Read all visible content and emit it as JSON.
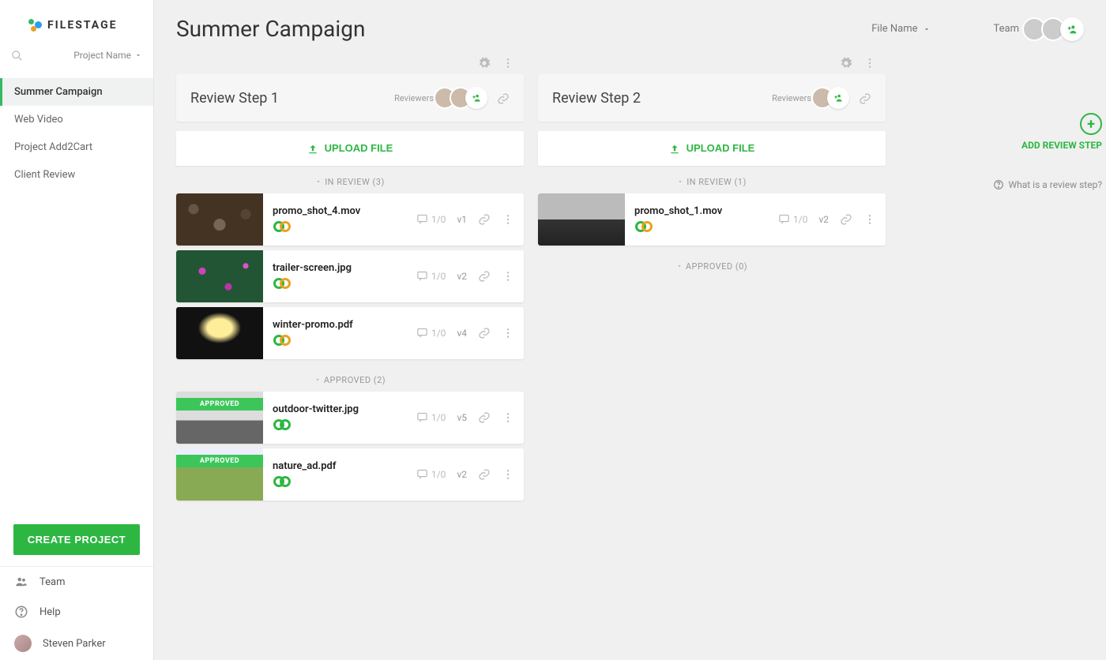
{
  "brand": "FILESTAGE",
  "sidebar": {
    "project_dropdown": "Project Name",
    "projects": [
      {
        "label": "Summer Campaign",
        "active": true
      },
      {
        "label": "Web Video",
        "active": false
      },
      {
        "label": "Project Add2Cart",
        "active": false
      },
      {
        "label": "Client Review",
        "active": false
      }
    ],
    "create_btn": "CREATE PROJECT",
    "footer": {
      "team": "Team",
      "help": "Help",
      "user": "Steven Parker"
    }
  },
  "header": {
    "title": "Summer Campaign",
    "filename_sort": "File Name",
    "team_label": "Team"
  },
  "labels": {
    "reviewers": "Reviewers",
    "upload": "UPLOAD FILE",
    "approved_banner": "APPROVED",
    "add_step": "ADD REVIEW STEP",
    "what_link": "What is a review step?"
  },
  "columns": [
    {
      "title": "Review Step 1",
      "reviewer_count": 2,
      "sections": [
        {
          "label": "IN REVIEW (3)",
          "files": [
            {
              "name": "promo_shot_4.mov",
              "comments": "1/0",
              "version": "v1",
              "thumb": "logs",
              "status": "pending"
            },
            {
              "name": "trailer-screen.jpg",
              "comments": "1/0",
              "version": "v2",
              "thumb": "flowers",
              "status": "pending"
            },
            {
              "name": "winter-promo.pdf",
              "comments": "1/0",
              "version": "v4",
              "thumb": "lights",
              "status": "pending"
            }
          ]
        },
        {
          "label": "APPROVED (2)",
          "files": [
            {
              "name": "outdoor-twitter.jpg",
              "comments": "1/0",
              "version": "v5",
              "thumb": "outdoor",
              "status": "approved"
            },
            {
              "name": "nature_ad.pdf",
              "comments": "1/0",
              "version": "v2",
              "thumb": "nature",
              "status": "approved"
            }
          ]
        }
      ]
    },
    {
      "title": "Review Step 2",
      "reviewer_count": 1,
      "sections": [
        {
          "label": "IN REVIEW (1)",
          "files": [
            {
              "name": "promo_shot_1.mov",
              "comments": "1/0",
              "version": "v2",
              "thumb": "mountain",
              "status": "pending"
            }
          ]
        },
        {
          "label": "APPROVED (0)",
          "files": []
        }
      ]
    }
  ]
}
